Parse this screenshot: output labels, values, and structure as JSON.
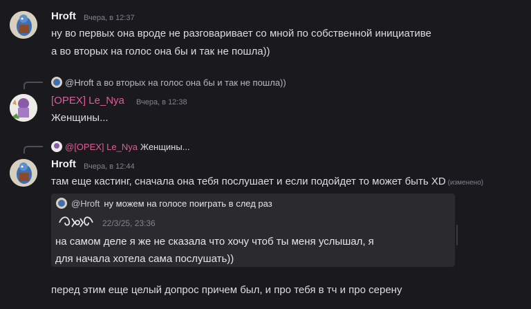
{
  "messages": [
    {
      "author": "Hroft",
      "timestamp": "Вчера, в 12:37",
      "lines": [
        "ну во первых она вроде не разговаривает со мной по собственной инициативе",
        "а во вторых на голос она бы и так не пошла))"
      ]
    },
    {
      "reply_to": {
        "author": "@Hroft",
        "text": "а во вторых на голос она бы и так не пошла))"
      },
      "author": "[OPEX] Le_Nya",
      "author_color": "#e05c9a",
      "timestamp": "Вчера, в 12:38",
      "lines": [
        "Женщины..."
      ]
    },
    {
      "reply_to": {
        "author": "@[OPEX] Le_Nya",
        "text": "Женщины..."
      },
      "author": "Hroft",
      "timestamp": "Вчера, в 12:44",
      "lines": [
        "там еще кастинг, сначала она тебя послушает и если подойдет то может быть XD"
      ],
      "edited_label": "(изменено)",
      "embed": {
        "quote_author": "@Hroft",
        "quote_text": "ну можем на голосе поиграть в след раз",
        "forward_timestamp": "22/3/25, 23:36",
        "body_lines": [
          "на самом деле я же не сказала что хочу чтоб ты меня услышал, я",
          "для начала хотела сама послушать))"
        ]
      },
      "after_lines": [
        "перед этим еще целый допрос причем был, и про тебя в тч и про серену"
      ]
    }
  ]
}
